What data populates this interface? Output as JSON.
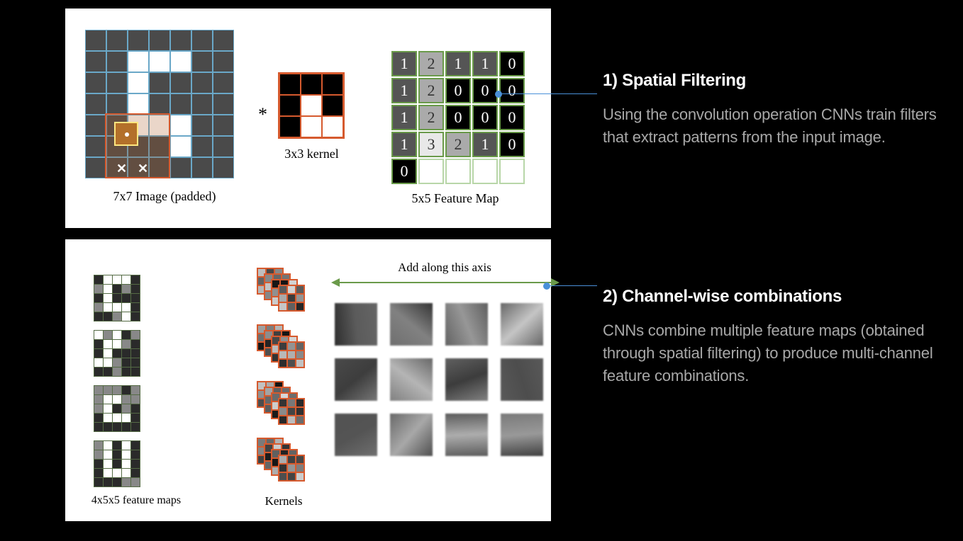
{
  "sections": {
    "spatial": {
      "heading": "1) Spatial Filtering",
      "body": "Using the convolution operation CNNs train filters that extract patterns from the input image."
    },
    "channel": {
      "heading": "2) Channel-wise combinations",
      "body": "CNNs combine multiple feature maps (obtained through spatial filtering) to produce multi-channel feature combinations."
    }
  },
  "top_panel": {
    "image_label": "7x7 Image (padded)",
    "kernel_label": "3x3 kernel",
    "featuremap_label": "5x5 Feature Map",
    "asterisk": "*",
    "image_white_cells": [
      [
        1,
        2
      ],
      [
        1,
        3
      ],
      [
        1,
        4
      ],
      [
        2,
        2
      ],
      [
        3,
        2
      ],
      [
        4,
        2
      ],
      [
        4,
        3
      ],
      [
        4,
        4
      ],
      [
        5,
        4
      ]
    ],
    "kernel_white_cells": [
      [
        1,
        1
      ],
      [
        2,
        1
      ],
      [
        2,
        2
      ]
    ],
    "feature_map": [
      [
        1,
        2,
        1,
        1,
        0
      ],
      [
        1,
        2,
        0,
        0,
        0
      ],
      [
        1,
        2,
        0,
        0,
        0
      ],
      [
        1,
        3,
        2,
        1,
        0
      ],
      [
        0,
        null,
        null,
        null,
        null
      ]
    ]
  },
  "bottom_panel": {
    "stack_label": "4x5x5 feature maps",
    "kernels_label": "Kernels",
    "arrow_label": "Add along this axis"
  }
}
